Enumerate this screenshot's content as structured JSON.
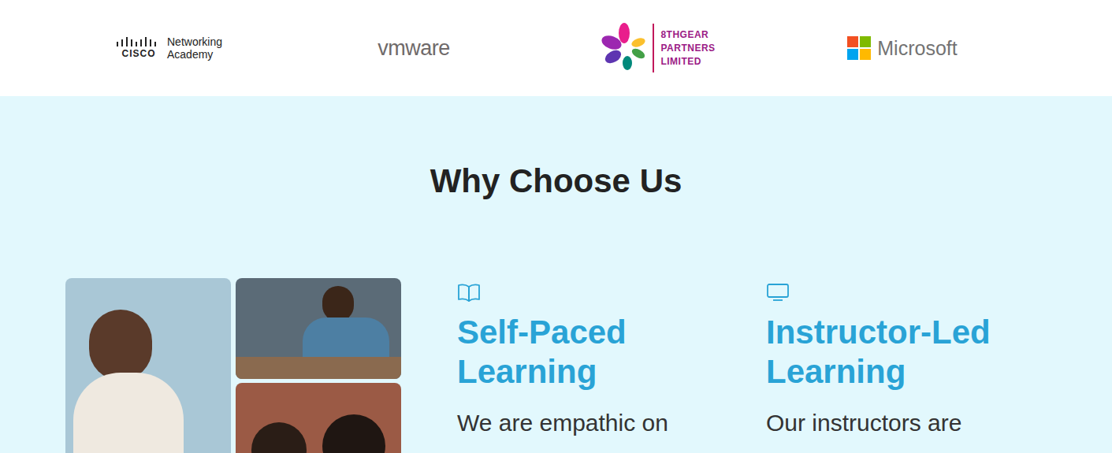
{
  "partners": [
    {
      "kind": "cisco",
      "brand": "CISCO",
      "lines": [
        "Networking",
        "Academy"
      ]
    },
    {
      "kind": "vmware",
      "brand": "vmware",
      "lines": []
    },
    {
      "kind": "eighthgear",
      "brand": "",
      "lines": [
        "8THGEAR",
        "PARTNERS",
        "LIMITED"
      ]
    },
    {
      "kind": "microsoft",
      "brand": "Microsoft",
      "lines": []
    }
  ],
  "section": {
    "title": "Why Choose Us"
  },
  "features": [
    {
      "title": "Self-Paced Learning",
      "text": "We are empathic on"
    },
    {
      "title": "Instructor-Led Learning",
      "text": "Our instructors are"
    }
  ]
}
